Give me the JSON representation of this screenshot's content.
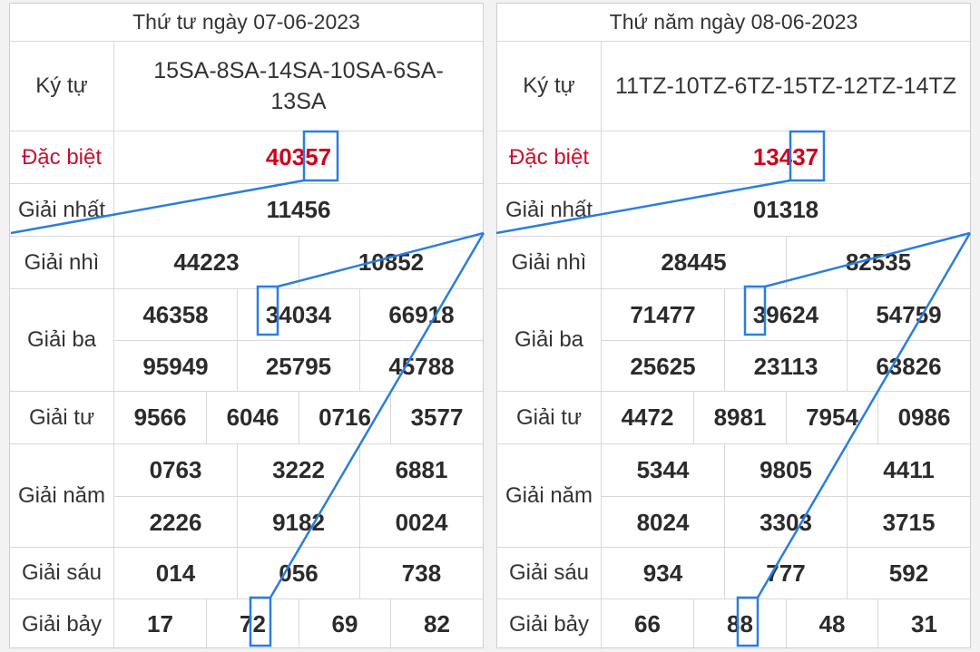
{
  "panels": [
    {
      "title": "Thứ tư ngày 07-06-2023",
      "labels": {
        "kytu": "Ký tự",
        "dacbiet": "Đặc biệt",
        "nhat": "Giải nhất",
        "nhi": "Giải nhì",
        "ba": "Giải ba",
        "tu": "Giải tư",
        "nam": "Giải năm",
        "sau": "Giải sáu",
        "bay": "Giải bảy"
      },
      "kytu": "15SA-8SA-14SA-10SA-6SA-13SA",
      "dacbiet": "40357",
      "nhat": "11456",
      "nhi": [
        "44223",
        "10852"
      ],
      "ba": [
        "46358",
        "34034",
        "66918",
        "95949",
        "25795",
        "45788"
      ],
      "tu": [
        "9566",
        "6046",
        "0716",
        "3577"
      ],
      "nam": [
        "0763",
        "3222",
        "6881",
        "2226",
        "9182",
        "0024"
      ],
      "sau": [
        "014",
        "056",
        "738"
      ],
      "bay": [
        "17",
        "72",
        "69",
        "82"
      ]
    },
    {
      "title": "Thứ năm ngày 08-06-2023",
      "labels": {
        "kytu": "Ký tự",
        "dacbiet": "Đặc biệt",
        "nhat": "Giải nhất",
        "nhi": "Giải nhì",
        "ba": "Giải ba",
        "tu": "Giải tư",
        "nam": "Giải năm",
        "sau": "Giải sáu",
        "bay": "Giải bảy"
      },
      "kytu": "11TZ-10TZ-6TZ-15TZ-12TZ-14TZ",
      "dacbiet": "13437",
      "nhat": "01318",
      "nhi": [
        "28445",
        "82535"
      ],
      "ba": [
        "71477",
        "39624",
        "54759",
        "25625",
        "23113",
        "63826"
      ],
      "tu": [
        "4472",
        "8981",
        "7954",
        "0986"
      ],
      "nam": [
        "5344",
        "9805",
        "4411",
        "8024",
        "3303",
        "3715"
      ],
      "sau": [
        "934",
        "777",
        "592"
      ],
      "bay": [
        "66",
        "88",
        "48",
        "31"
      ]
    }
  ],
  "colors": {
    "highlight": "#2a7de1",
    "special": "#d0021b"
  }
}
